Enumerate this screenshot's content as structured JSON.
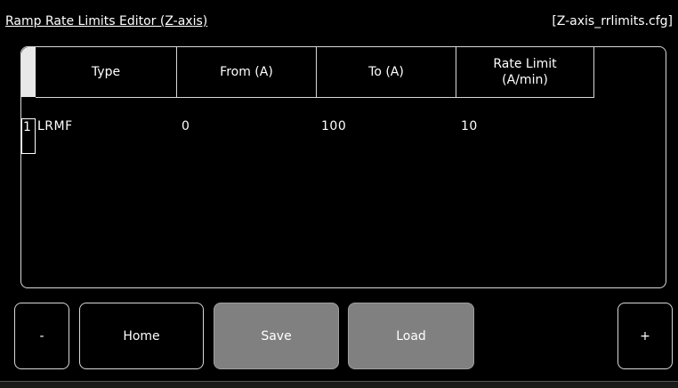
{
  "header": {
    "title": "Ramp Rate Limits Editor (Z-axis)",
    "filename": "[Z-axis_rrlimits.cfg]"
  },
  "table": {
    "columns": [
      "Type",
      "From (A)",
      "To (A)",
      "Rate Limit\n(A/min)"
    ],
    "rows": [
      {
        "index": "1",
        "cells": [
          "LRMF",
          "0",
          "100",
          "10"
        ]
      }
    ]
  },
  "buttons": {
    "minus": "-",
    "home": "Home",
    "save": "Save",
    "load": "Load",
    "plus": "+"
  },
  "colors": {
    "background": "#000000",
    "text": "#ffffff",
    "disabled_button": "#808080",
    "border": "#d8d8d8"
  }
}
